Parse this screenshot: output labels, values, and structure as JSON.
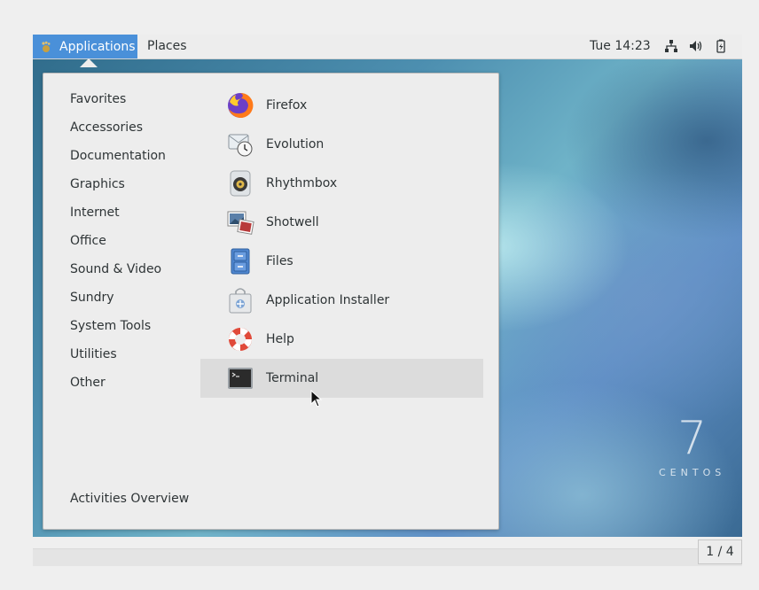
{
  "topbar": {
    "applications_label": "Applications",
    "places_label": "Places",
    "clock": "Tue 14:23",
    "tray_icons": [
      "network-icon",
      "volume-icon",
      "battery-icon"
    ]
  },
  "menu": {
    "categories": [
      {
        "label": "Favorites"
      },
      {
        "label": "Accessories"
      },
      {
        "label": "Documentation"
      },
      {
        "label": "Graphics"
      },
      {
        "label": "Internet"
      },
      {
        "label": "Office"
      },
      {
        "label": "Sound & Video"
      },
      {
        "label": "Sundry"
      },
      {
        "label": "System Tools"
      },
      {
        "label": "Utilities"
      },
      {
        "label": "Other"
      }
    ],
    "activities_label": "Activities Overview",
    "apps": [
      {
        "label": "Firefox",
        "icon": "firefox-icon"
      },
      {
        "label": "Evolution",
        "icon": "evolution-icon"
      },
      {
        "label": "Rhythmbox",
        "icon": "rhythmbox-icon"
      },
      {
        "label": "Shotwell",
        "icon": "shotwell-icon"
      },
      {
        "label": "Files",
        "icon": "files-icon"
      },
      {
        "label": "Application Installer",
        "icon": "application-installer-icon"
      },
      {
        "label": "Help",
        "icon": "help-icon"
      },
      {
        "label": "Terminal",
        "icon": "terminal-icon"
      }
    ],
    "selected_app": "Terminal"
  },
  "desktop": {
    "logo_number": "7",
    "logo_word": "CENTOS"
  },
  "workspace": {
    "pager_label": "1 / 4"
  },
  "colors": {
    "accent": "#4a90d9",
    "panel": "#ededed",
    "selected_row": "#dcdcdc"
  }
}
